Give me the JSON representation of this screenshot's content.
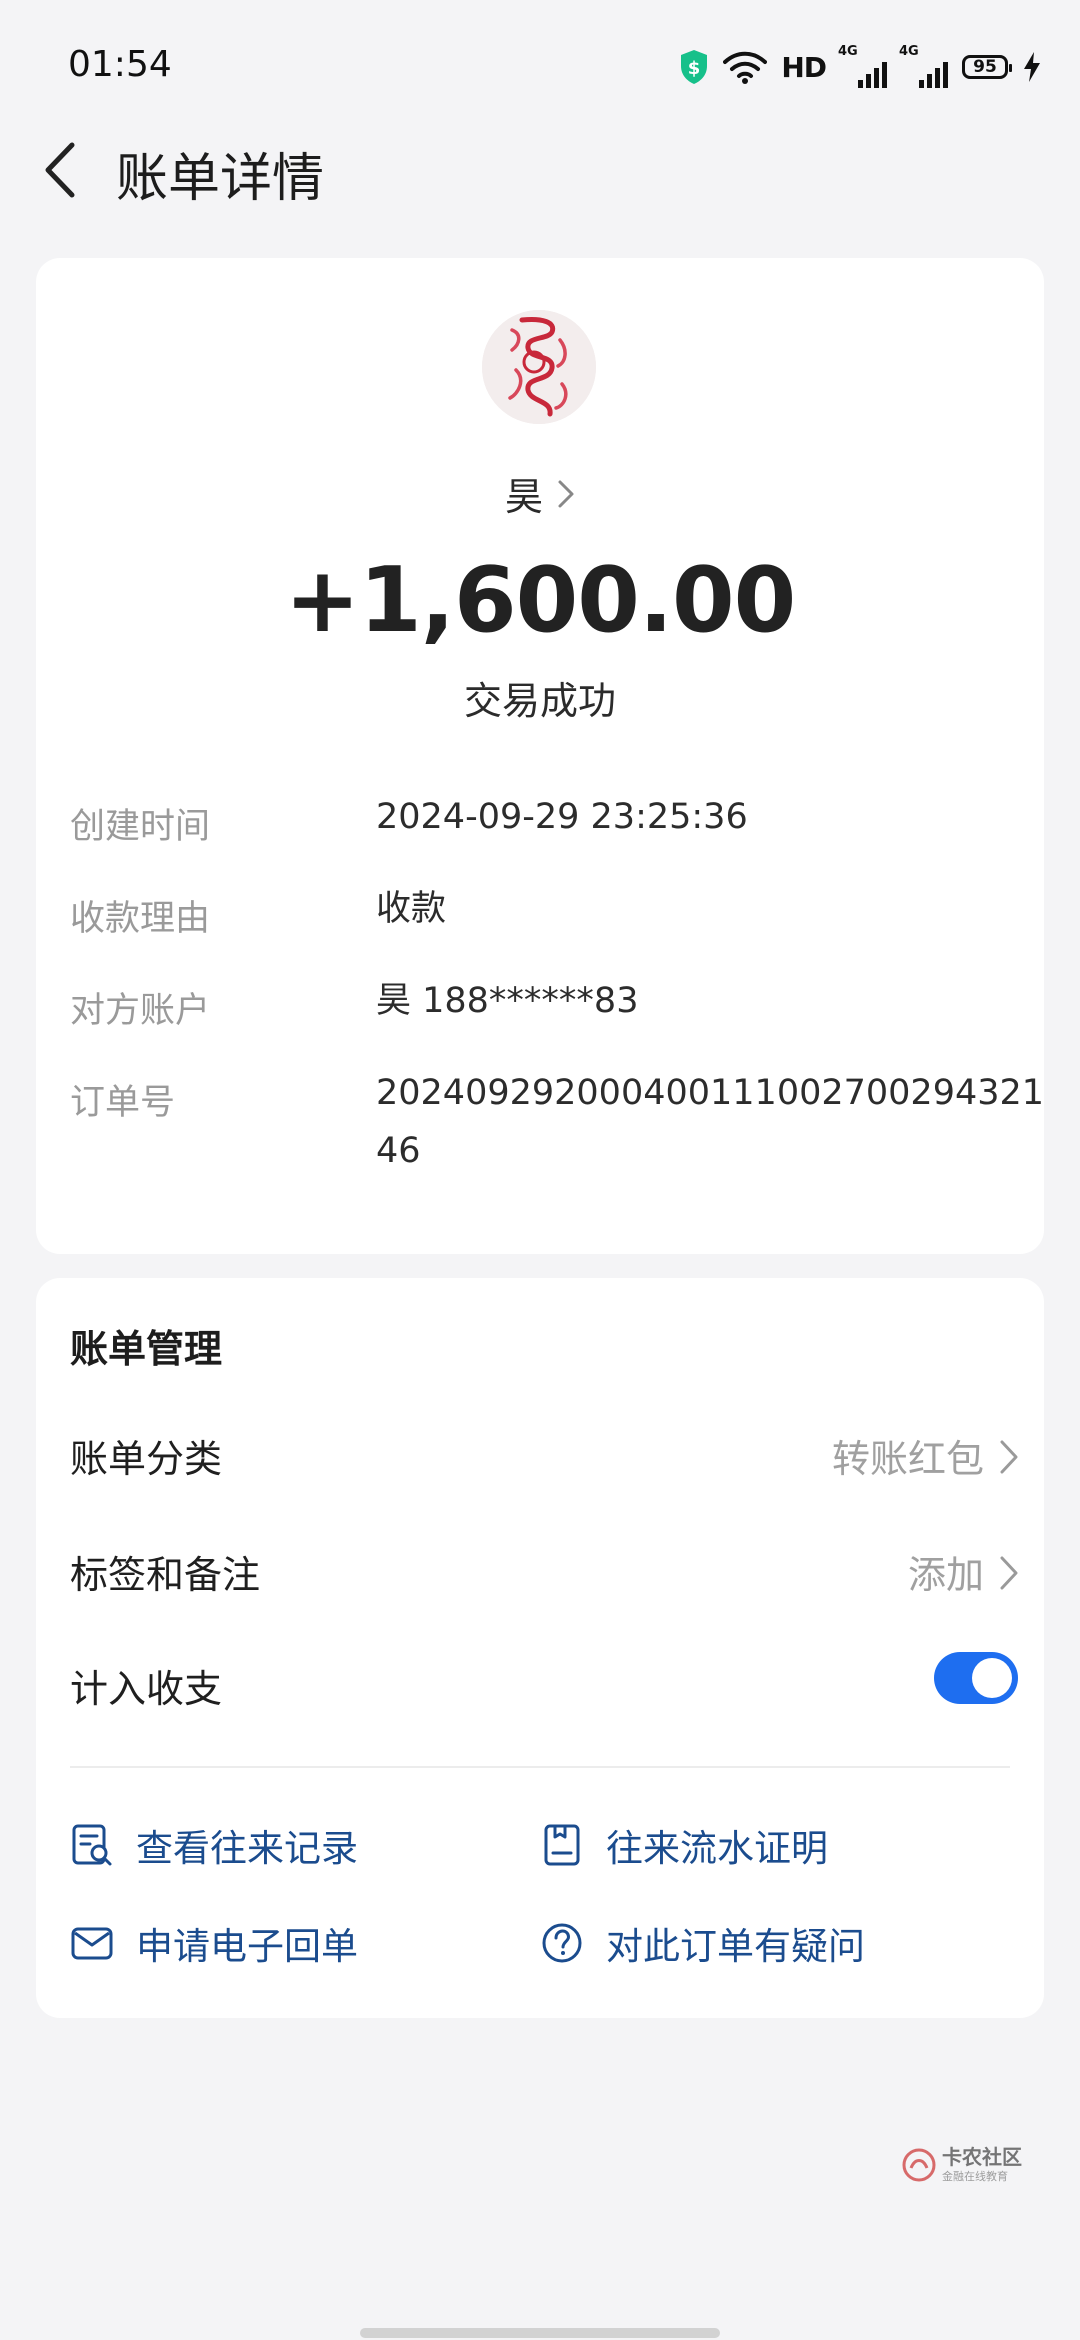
{
  "status_bar": {
    "time": "01:54",
    "network_label": "HD",
    "signal_tag_1": "4G",
    "signal_tag_2": "4G",
    "battery": "95",
    "icons": [
      "shield-icon",
      "wifi-icon",
      "signal-icon",
      "battery-icon",
      "charging-icon"
    ]
  },
  "header": {
    "title": "账单详情",
    "back_icon": "chevron-left-icon"
  },
  "summary": {
    "payee_name": "昊",
    "amount": "+1,600.00",
    "status": "交易成功"
  },
  "details": [
    {
      "label": "创建时间",
      "value": "2024-09-29 23:25:36"
    },
    {
      "label": "收款理由",
      "value": "收款"
    },
    {
      "label": "对方账户",
      "value": "昊 188******83"
    },
    {
      "label": "订单号",
      "value": "20240929200040011100270029432146"
    }
  ],
  "management": {
    "title": "账单管理",
    "category_label": "账单分类",
    "category_value": "转账红包",
    "tags_label": "标签和备注",
    "tags_value": "添加",
    "include_label": "计入收支",
    "include_on": true
  },
  "actions": {
    "history": "查看往来记录",
    "statement": "往来流水证明",
    "receipt": "申请电子回单",
    "question": "对此订单有疑问"
  },
  "watermark": {
    "text": "卡农社区",
    "sub": "金融在线教育"
  },
  "colors": {
    "accent": "#1e6ef0",
    "link": "#1b4c8e",
    "background": "#f4f4f6",
    "secure_green": "#16c08a"
  }
}
